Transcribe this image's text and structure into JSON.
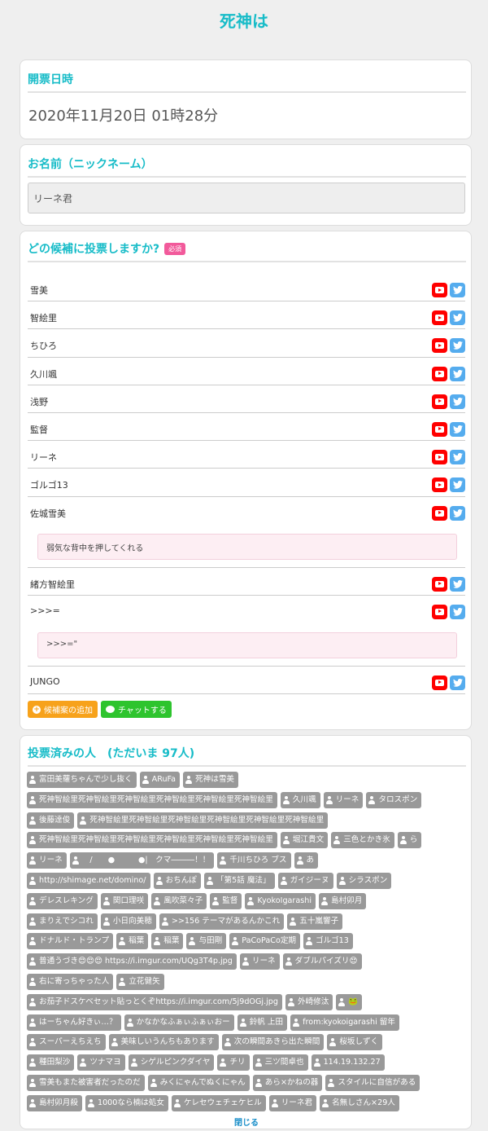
{
  "page": {
    "title": "死神は"
  },
  "date_section": {
    "title": "開票日時",
    "value": "2020年11月20日 01時28分"
  },
  "name_section": {
    "title": "お名前（ニックネーム）",
    "value": "リーネ君"
  },
  "vote_section": {
    "title": "どの候補に投票しますか?",
    "required_badge": "必須",
    "candidates": [
      {
        "name": "雪美",
        "comment": ""
      },
      {
        "name": "智絵里",
        "comment": ""
      },
      {
        "name": "ちひろ",
        "comment": ""
      },
      {
        "name": "久川颯",
        "comment": ""
      },
      {
        "name": "浅野",
        "comment": ""
      },
      {
        "name": "監督",
        "comment": ""
      },
      {
        "name": "リーネ",
        "comment": ""
      },
      {
        "name": "ゴルゴ13",
        "comment": ""
      },
      {
        "name": "佐城雪美",
        "comment": "弱気な背中を押してくれる"
      },
      {
        "name": "緒方智絵里",
        "comment": ""
      },
      {
        "name": ">>>=",
        "comment": ">>>=\""
      },
      {
        "name": "JUNGO",
        "comment": ""
      }
    ],
    "add_candidate_label": "候補案の追加",
    "chat_label": "チャットする"
  },
  "voters_section": {
    "title": "投票済みの人　(ただいま 97人)",
    "close_label": "閉じる",
    "rows": [
      [
        "富田美蘿ちゃんで少し抜く",
        "ARuFa",
        "死神は雪美"
      ],
      [
        "死神智絵里死神智絵里死神智絵里死神智絵里死神智絵里死神智絵里",
        "久川颯",
        "リーネ",
        "タロスポン"
      ],
      [
        "後藤達俊",
        "死神智絵里死神智絵里死神智絵里死神智絵里死神智絵里死神智絵里"
      ],
      [
        "死神智絵里死神智絵里死神智絵里死神智絵里死神智絵里死神智絵里",
        "堀江貴文",
        "三色とかき氷",
        "ら"
      ],
      [
        "リーネ",
        "　/　　●　　　●|　クマ―――！！",
        "千川ちひろ ブス",
        "あ"
      ],
      [
        "http://shimage.net/domino/",
        "おちんぽ",
        "「第5話 魔法」",
        "ガイジーヌ",
        "シラスポン"
      ],
      [
        "デレスレキング",
        "関口理咲",
        "風吹菜々子",
        "監督",
        "KyokoIgarashi",
        "島村卯月"
      ],
      [
        "まりえでシコれ",
        "小日向美穂",
        ">>156 テーマがあるんかこれ",
        "五十嵐響子"
      ],
      [
        "ドナルド・トランプ",
        "稲葉",
        "稲葉",
        "与田剛",
        "PaCoPaCo定期",
        "ゴルゴ13"
      ],
      [
        "普通うづき😍😍😍 https://i.imgur.com/UQg3T4p.jpg",
        "リーネ",
        "ダブルパイズリ😍"
      ],
      [
        "右に寄っちゃった人",
        "立花健矢"
      ],
      [
        "お茄子ドスケベセット貼っとくぞhttps://i.imgur.com/5j9dOGj.jpg",
        "外崎修汰",
        "🐸"
      ],
      [
        "はーちゃん好きぃ…？",
        "かなかなふぁぃふぁぃおー",
        "鈴帆 上田",
        "from:kyokoigarashi 留年"
      ],
      [
        "スーパーえちえち",
        "美味しいうんちもあります",
        "次の瞬間あきら出た瞬間",
        "桜坂しずく"
      ],
      [
        "種田梨沙",
        "ツナマヨ",
        "シゲルピンクダイヤ",
        "チリ",
        "三ツ間卓也",
        "114.19.132.27"
      ],
      [
        "雪美もまた被害者だったのだ",
        "みくにゃんでぬくにゃん",
        "あら×かねの器",
        "スタイルに自信がある"
      ],
      [
        "島村卯月殺",
        "1000なら楠は処女",
        "ケレセウェチェケヒル",
        "リーネ君",
        "名無しさん×29人"
      ]
    ]
  }
}
